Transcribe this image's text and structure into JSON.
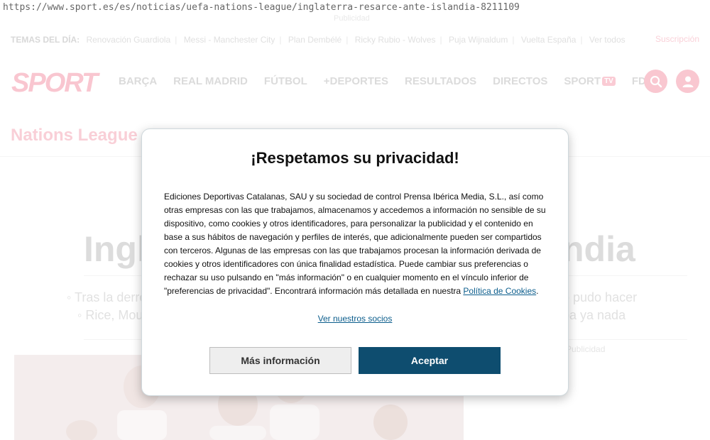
{
  "browser": {
    "url": "https://www.sport.es/es/noticias/uefa-nations-league/inglaterra-resarce-ante-islandia-8211109"
  },
  "ads": {
    "top_label": "Publicidad",
    "mid_label": "Publicidad"
  },
  "topics": {
    "lead": "TEMAS DEL DÍA:",
    "items": [
      "Renovación Guardiola",
      "Messi - Manchester City",
      "Plan Dembélé",
      "Ricky Rubio - Wolves",
      "Puja Wijnaldum",
      "Vuelta España",
      "Ver todos"
    ]
  },
  "header": {
    "subscribe": "Suscripción",
    "logo": "SPORT",
    "nav": [
      "BARÇA",
      "REAL MADRID",
      "FÚTBOL",
      "+DEPORTES",
      "RESULTADOS",
      "DIRECTOS"
    ],
    "nav_sport": "SPORT",
    "nav_tv_badge": "TV",
    "nav_last": "FDJ",
    "icons": [
      "search-icon",
      "user-icon"
    ]
  },
  "article": {
    "section": "Nations League",
    "headline_left": "Ingl",
    "headline_right": "ndia",
    "bullet_1_left": "◦ Tras la derro",
    "bullet_1_right": "o pudo hacer",
    "bullet_2_left": "◦ Rice, Mou",
    "bullet_2_right": "ba ya nada"
  },
  "consent": {
    "title": "¡Respetamos su privacidad!",
    "body": "Ediciones Deportivas Catalanas, SAU y su sociedad de control Prensa Ibérica Media, S.L., así como otras empresas con las que trabajamos, almacenamos y accedemos a información no sensible de su dispositivo, como cookies y otros identificadores, para personalizar la publicidad y el contenido en base a sus hábitos de navegación y perfiles de interés, que adicionalmente pueden ser compartidos con terceros. Algunas de las empresas con las que trabajamos procesan la información derivada de cookies y otros identificadores con única finalidad estadística. Puede cambiar sus preferencias o rechazar su uso pulsando en \"más información\" o en cualquier momento en el vínculo inferior de \"preferencias de privacidad\". Encontrará información más detallada en nuestra ",
    "cookie_link": "Política de Cookies",
    "body_end": ".",
    "partners_link": "Ver nuestros socios",
    "more_button": "Más información",
    "accept_button": "Aceptar",
    "accept_color": "#0e4d6f"
  }
}
